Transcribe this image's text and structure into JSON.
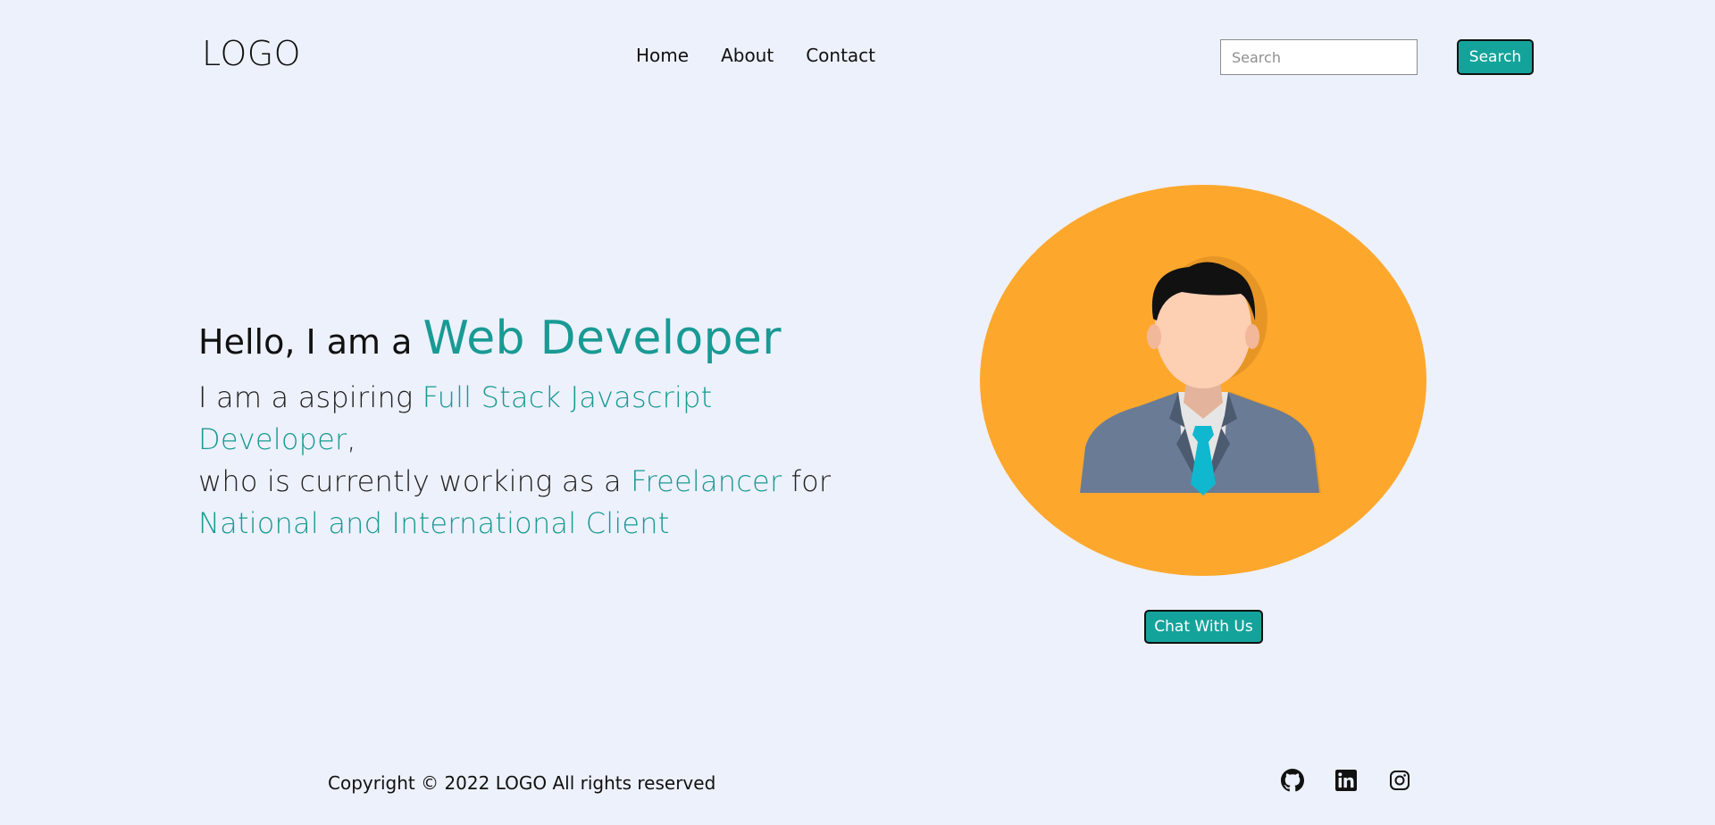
{
  "header": {
    "logo": "LOGO",
    "nav": [
      {
        "label": "Home"
      },
      {
        "label": "About"
      },
      {
        "label": "Contact"
      }
    ],
    "search": {
      "placeholder": "Search",
      "value": "",
      "button_label": "Search"
    }
  },
  "hero": {
    "greeting": "Hello, I am a",
    "role": "Web Developer",
    "line1_plain": "I am a aspiring",
    "line1_accent": "Full Stack Javascript Developer",
    "line1_end": ",",
    "line2_plain": "who is currently working as a",
    "line2_accent": "Freelancer",
    "line2_end": "for",
    "line3_accent": "National and International Client",
    "avatar_icon": "businessman-avatar-icon",
    "chat_button": "Chat With Us"
  },
  "footer": {
    "copyright": "Copyright © 2022 LOGO All rights reserved",
    "socials": [
      {
        "icon": "github-icon"
      },
      {
        "icon": "linkedin-icon"
      },
      {
        "icon": "instagram-icon"
      }
    ]
  },
  "colors": {
    "background": "#edf1fb",
    "accent": "#199a94",
    "button": "#14a39b",
    "avatar_circle": "#fda82d"
  }
}
